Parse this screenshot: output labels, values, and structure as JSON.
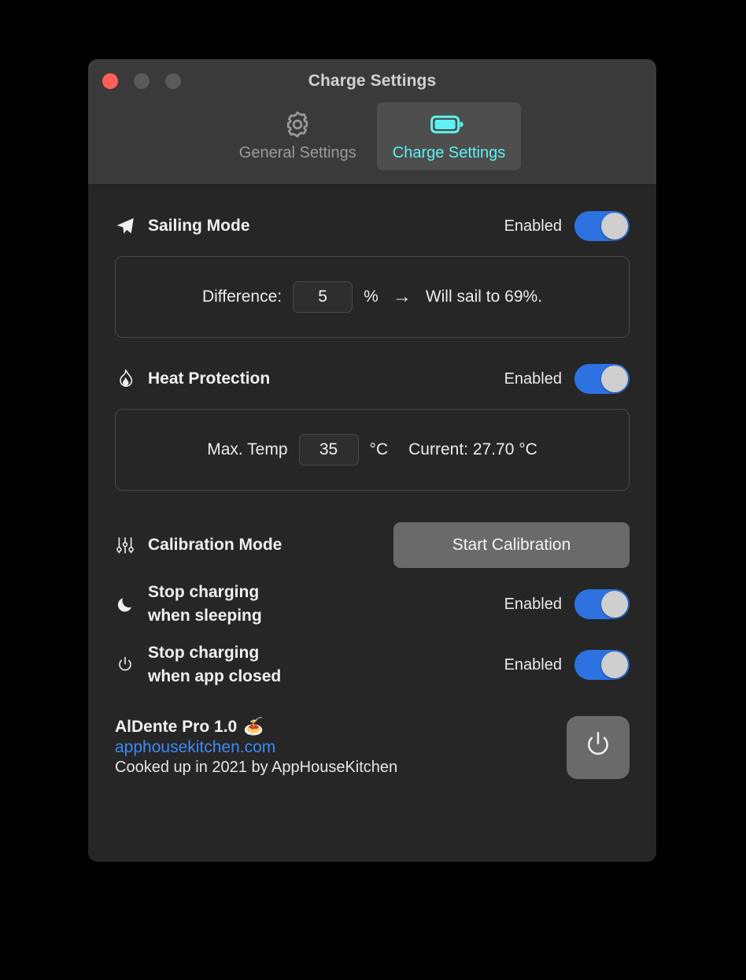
{
  "window": {
    "title": "Charge Settings",
    "traffic_lights": [
      {
        "name": "close",
        "color": "#ff5f56",
        "state": "active"
      },
      {
        "name": "minimize",
        "color": "#5a5a5a",
        "state": "inactive"
      },
      {
        "name": "zoom",
        "color": "#5a5a5a",
        "state": "inactive"
      }
    ]
  },
  "tabs": [
    {
      "label": "General Settings",
      "icon": "gear-icon",
      "active": false
    },
    {
      "label": "Charge Settings",
      "icon": "battery-icon",
      "active": true
    }
  ],
  "sections": {
    "sailing": {
      "title": "Sailing Mode",
      "icon": "paper-plane-icon",
      "toggle_label": "Enabled",
      "toggle_on": true,
      "panel": {
        "label": "Difference:",
        "value": "5",
        "unit": "%",
        "arrow": "→",
        "result": "Will sail to 69%."
      }
    },
    "heat": {
      "title": "Heat Protection",
      "icon": "flame-icon",
      "toggle_label": "Enabled",
      "toggle_on": true,
      "panel": {
        "label": "Max. Temp",
        "value": "35",
        "unit": "°C",
        "current": "Current: 27.70 °C"
      }
    },
    "calibration": {
      "title": "Calibration Mode",
      "icon": "sliders-icon",
      "button_label": "Start Calibration"
    },
    "sleep": {
      "title_line1": "Stop charging",
      "title_line2": "when sleeping",
      "icon": "moon-icon",
      "toggle_label": "Enabled",
      "toggle_on": true
    },
    "app_closed": {
      "title_line1": "Stop charging",
      "title_line2": "when app closed",
      "icon": "power-icon",
      "toggle_label": "Enabled",
      "toggle_on": true
    }
  },
  "footer": {
    "app_name": "AlDente Pro 1.0",
    "app_emoji": "🍝",
    "link": "apphousekitchen.com",
    "credit": "Cooked up in 2021 by AppHouseKitchen",
    "power_button_icon": "power-icon"
  },
  "colors": {
    "accent_cyan": "#5df3f3",
    "toggle_blue": "#2d72e0",
    "link_blue": "#3b8bf5",
    "window_bg": "#262626",
    "toolbar_bg": "#3a3a3a",
    "button_gray": "#6a6a6a"
  }
}
